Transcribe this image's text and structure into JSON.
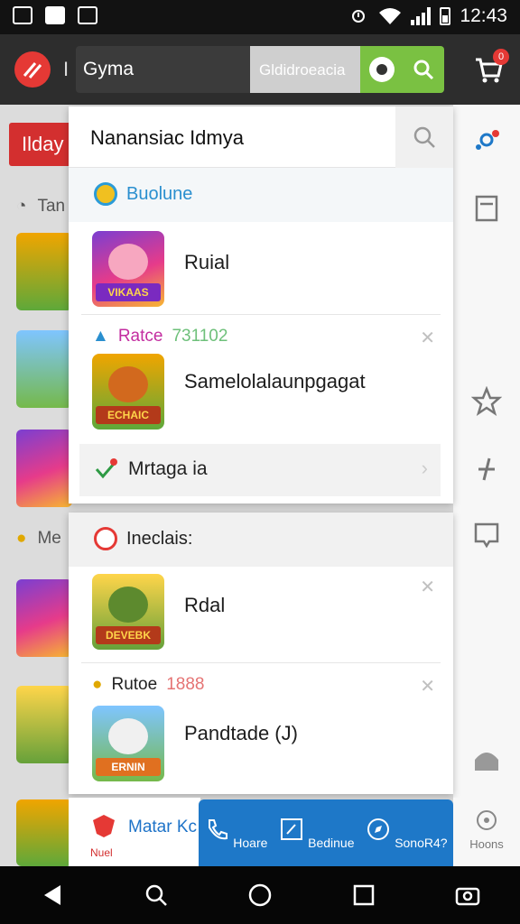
{
  "status": {
    "time": "12:43"
  },
  "appbar": {
    "search_query": "Gyma",
    "search_middle": "Gldidroeacia",
    "cart_badge": "0"
  },
  "background": {
    "red_button": "Ilday",
    "row1": "Tan",
    "row2": "Me"
  },
  "dropdown": {
    "search_text": "Nanansiac Idmya",
    "section1": {
      "label": "Buolune"
    },
    "item1": {
      "name": "Ruial",
      "art_text": "VIKAAS"
    },
    "subheader1": {
      "label": "Ratce",
      "number": "731102"
    },
    "item2": {
      "name": "Samelolalaunpgagat",
      "art_text": "ECHAIC"
    },
    "grey_row": {
      "label": "Mrtaga ia"
    }
  },
  "dropdown2": {
    "section_label": "Ineclais:",
    "item1": {
      "name": "Rdal",
      "art_text": "DEVEBK"
    },
    "subheader": {
      "label": "Rutoe",
      "number": "1888"
    },
    "item2": {
      "name": "Pandtade (J)",
      "art_text": "ERNIN"
    }
  },
  "bottom": {
    "left_label": "Matar Kc",
    "left_sub": "Nuel",
    "buttons": [
      {
        "label": "Hoare",
        "icon": "phone-icon"
      },
      {
        "label": "Bedinue",
        "icon": "edit-icon"
      },
      {
        "label": "SonoR4?",
        "icon": "compass-icon"
      }
    ],
    "right_label": "Hoons"
  },
  "colors": {
    "accent_green": "#7ac142",
    "brand_red": "#e53935",
    "bottom_blue": "#1e78c8"
  }
}
